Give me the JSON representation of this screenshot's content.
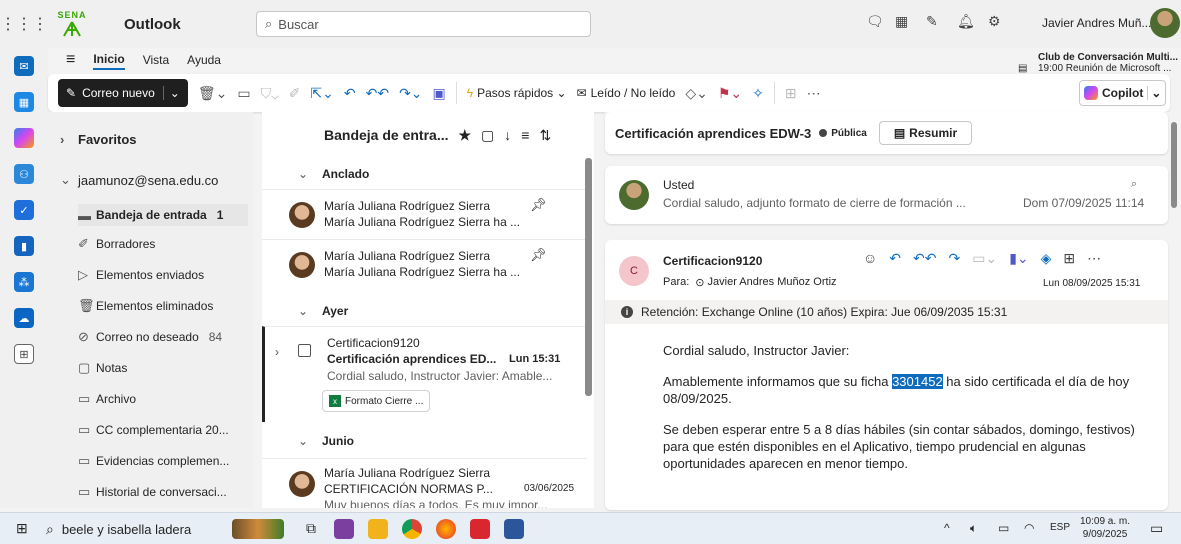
{
  "app": {
    "name": "Outlook",
    "logo_text": "SENA"
  },
  "search": {
    "placeholder": "Buscar"
  },
  "user": {
    "name": "Javier Andres Muñ..."
  },
  "tabs": [
    "Inicio",
    "Vista",
    "Ayuda"
  ],
  "ribbon": {
    "new_mail": "Correo nuevo",
    "quick_steps": "Pasos rápidos",
    "read_unread": "Leído / No leído",
    "copilot": "Copilot"
  },
  "event": {
    "title": "Club de Conversación Multi...",
    "detail": "19:00 Reunión de Microsoft ..."
  },
  "folders": {
    "favorites": "Favoritos",
    "account": "jaamunoz@sena.edu.co",
    "items": [
      {
        "label": "Bandeja de entrada",
        "count": "1",
        "icon": "inbox-icon"
      },
      {
        "label": "Borradores",
        "count": "",
        "icon": "drafts-icon"
      },
      {
        "label": "Elementos enviados",
        "count": "",
        "icon": "sent-icon"
      },
      {
        "label": "Elementos eliminados",
        "count": "",
        "icon": "trash-icon"
      },
      {
        "label": "Correo no deseado",
        "count": "84",
        "icon": "junk-icon"
      },
      {
        "label": "Notas",
        "count": "",
        "icon": "notes-icon"
      },
      {
        "label": "Archivo",
        "count": "",
        "icon": "archive-icon"
      },
      {
        "label": "CC complementaria 20...",
        "count": "",
        "icon": "folder-icon"
      },
      {
        "label": "Evidencias complemen...",
        "count": "",
        "icon": "folder-icon"
      },
      {
        "label": "Historial de conversaci...",
        "count": "",
        "icon": "folder-icon"
      }
    ]
  },
  "list": {
    "title": "Bandeja de entra...",
    "groups": {
      "pinned": "Anclado",
      "yesterday": "Ayer",
      "june": "Junio"
    },
    "pinned": [
      {
        "from": "María Juliana Rodríguez Sierra",
        "preview": "María Juliana Rodríguez Sierra ha ..."
      },
      {
        "from": "María Juliana Rodríguez Sierra",
        "preview": "María Juliana Rodríguez Sierra ha ..."
      }
    ],
    "selected": {
      "from": "Certificacion9120",
      "subject": "Certificación aprendices ED...",
      "time": "Lun 15:31",
      "preview": "Cordial saludo, Instructor Javier: Amable...",
      "attachment": "Formato Cierre ..."
    },
    "june_msg": {
      "from": "María Juliana Rodríguez Sierra",
      "subject": "CERTIFICACIÓN NORMAS P...",
      "date": "03/06/2025",
      "preview": "Muy buenos días a todos. Es muy impor..."
    }
  },
  "reading": {
    "subject": "Certificación aprendices EDW-3",
    "visibility": "Pública",
    "summarize": "Resumir",
    "thread1": {
      "from": "Usted",
      "preview": "Cordial saludo, adjunto formato de cierre de formación ...",
      "date": "Dom 07/09/2025 11:14"
    },
    "thread2": {
      "avatar_letter": "C",
      "from": "Certificacion9120",
      "to_label": "Para:",
      "to": "Javier Andres Muñoz Ortiz",
      "date": "Lun 08/09/2025 15:31",
      "retention": "Retención: Exchange Online (10 años) Expira: Jue 06/09/2035 15:31",
      "greeting": "Cordial saludo, Instructor Javier:",
      "p1_pre": "Amablemente informamos que su ficha ",
      "p1_ficha": "3301452",
      "p1_post": " ha sido certificada el día de hoy 08/09/2025.",
      "p2": "Se deben esperar entre 5 a 8 días hábiles (sin contar sábados, domingo, festivos) para que estén disponibles en el Aplicativo, tiempo prudencial en algunas oportunidades aparecen en menor tiempo."
    }
  },
  "taskbar": {
    "search": "beele y isabella ladera",
    "lang": "ESP",
    "time": "10:09 a. m.",
    "date": "9/09/2025"
  }
}
